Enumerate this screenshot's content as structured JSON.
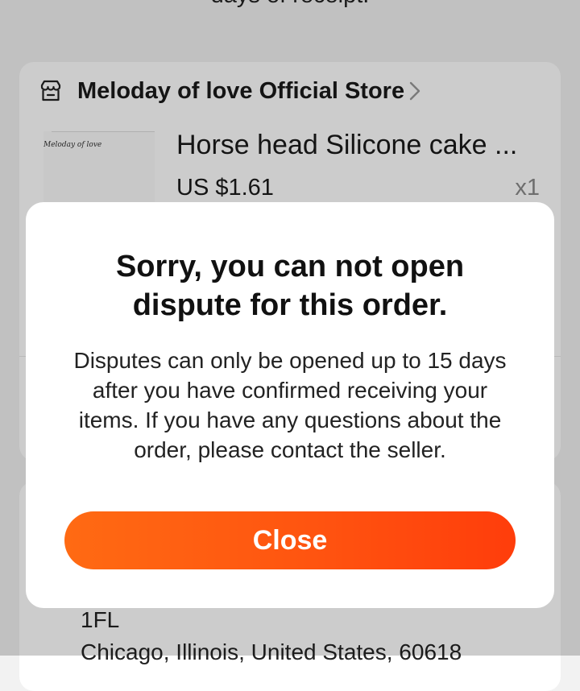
{
  "page": {
    "top_text": "days of receipt."
  },
  "store": {
    "name": "Meloday of love Official Store",
    "icon": "store-icon",
    "chevron_icon": "chevron-right-icon"
  },
  "product": {
    "thumbnail_text": "Meloday of love",
    "title": "Horse head Silicone cake ...",
    "price": "US $1.61",
    "quantity": "x1"
  },
  "address": {
    "line1": "1FL",
    "line2": "Chicago, Illinois, United States, 60618"
  },
  "dialog": {
    "title": "Sorry, you can not open dispute for this order.",
    "message": "Disputes can only be opened up to 15 days after you have confirmed receiving your items. If you have any questions about the order, please contact the seller.",
    "close_label": "Close"
  },
  "colors": {
    "accent_start": "#ff6a13",
    "accent_end": "#ff3d0b",
    "overlay": "rgba(0,0,0,0.2)",
    "thumbnail_pink": "#e8638f"
  }
}
